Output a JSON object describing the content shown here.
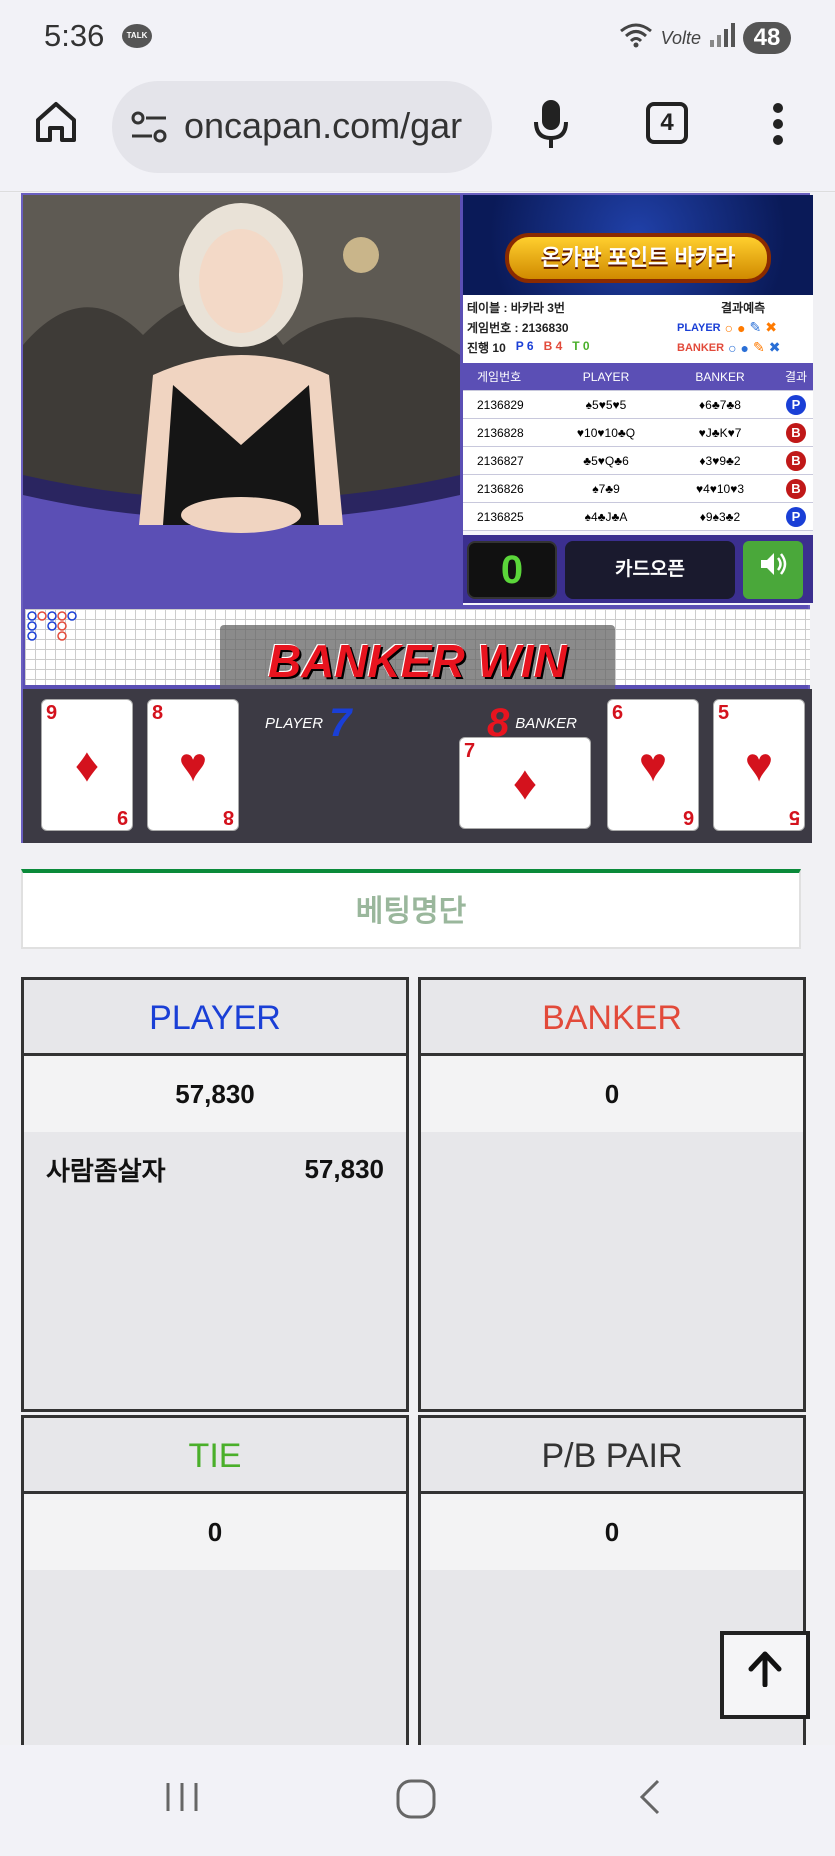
{
  "status_bar": {
    "time": "5:36",
    "notif_talk": "TALK",
    "network": "Volte",
    "battery": "48"
  },
  "browser": {
    "url": "oncapan.com/gar",
    "tab_count": "4"
  },
  "game": {
    "banner_title": "온카판 포인트 바카라",
    "table_label": "테이블 : 바카라 3번",
    "game_no_label": "게임번호 : 2136830",
    "progress_label": "진행 10",
    "p_count": "P 6",
    "b_count": "B 4",
    "t_count": "T 0",
    "predict_label": "결과예측",
    "predict_player": "PLAYER",
    "predict_banker": "BANKER",
    "history_headers": [
      "게임번호",
      "PLAYER",
      "BANKER",
      "결과"
    ],
    "history": [
      {
        "no": "2136829",
        "player": "♠5♥5♥5",
        "banker": "♦6♣7♣8",
        "result": "P"
      },
      {
        "no": "2136828",
        "player": "♥10♥10♣Q",
        "banker": "♥J♣K♥7",
        "result": "B"
      },
      {
        "no": "2136827",
        "player": "♣5♥Q♣6",
        "banker": "♦3♥9♣2",
        "result": "B"
      },
      {
        "no": "2136826",
        "player": "♠7♣9",
        "banker": "♥4♥10♥3",
        "result": "B"
      },
      {
        "no": "2136825",
        "player": "♠4♣J♣A",
        "banker": "♦9♠3♣2",
        "result": "P"
      }
    ],
    "counter": "0",
    "card_open": "카드오픈",
    "win_text": "BANKER WIN",
    "player_label": "PLAYER",
    "player_score": "7",
    "banker_label": "BANKER",
    "banker_score": "8",
    "player_cards": [
      {
        "rank": "9",
        "suit": "♦"
      },
      {
        "rank": "8",
        "suit": "♥"
      }
    ],
    "banker_cards": [
      {
        "rank": "7",
        "suit": "♦"
      },
      {
        "rank": "6",
        "suit": "♥"
      },
      {
        "rank": "5",
        "suit": "♥"
      }
    ]
  },
  "betting": {
    "heading": "베팅명단",
    "player": {
      "label": "PLAYER",
      "total": "57,830",
      "entries": [
        {
          "name": "사람좀살자",
          "amount": "57,830"
        }
      ]
    },
    "banker": {
      "label": "BANKER",
      "total": "0"
    },
    "tie": {
      "label": "TIE",
      "total": "0"
    },
    "pair": {
      "label": "P/B PAIR",
      "total": "0"
    }
  },
  "colors": {
    "player": "#1a3fd6",
    "banker": "#e24a3a",
    "tie": "#4aaf2a",
    "accent_green": "#0a8a3a"
  }
}
